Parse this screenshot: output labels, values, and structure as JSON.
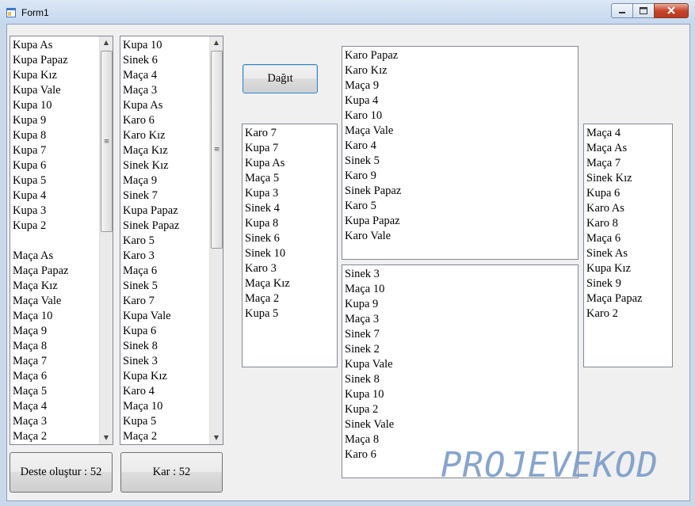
{
  "window": {
    "title": "Form1",
    "controls": [
      "minimize",
      "maximize",
      "close"
    ]
  },
  "deck_list": {
    "items": [
      "Kupa As",
      "Kupa Papaz",
      "Kupa Kız",
      "Kupa Vale",
      "Kupa 10",
      "Kupa 9",
      "Kupa 8",
      "Kupa 7",
      "Kupa 6",
      "Kupa 5",
      "Kupa 4",
      "Kupa 3",
      "Kupa 2",
      "",
      "Maça As",
      "Maça Papaz",
      "Maça Kız",
      "Maça Vale",
      "Maça 10",
      "Maça 9",
      "Maça 8",
      "Maça 7",
      "Maça 6",
      "Maça 5",
      "Maça 4",
      "Maça 3",
      "Maça 2"
    ]
  },
  "shuffled_list": {
    "items": [
      "Kupa 10",
      "Sinek 6",
      "Maça 4",
      "Maça 3",
      "Kupa As",
      "Karo 6",
      "Karo Kız",
      "Maça Kız",
      "Sinek Kız",
      "Maça 9",
      "Sinek 7",
      "Kupa Papaz",
      "Sinek Papaz",
      "Karo 5",
      "Karo 3",
      "Maça 6",
      "Sinek 5",
      "Karo 7",
      "Kupa Vale",
      "Kupa 6",
      "Sinek 8",
      "Sinek 3",
      "Kupa Kız",
      "Karo 4",
      "Maça 10",
      "Kupa 5",
      "Maça 2"
    ]
  },
  "buttons": {
    "deal": "Dağıt",
    "create_deck": "Deste oluştur : 52",
    "shuffle": "Kar : 52"
  },
  "players": {
    "left": [
      "Karo 7",
      "Kupa 7",
      "Kupa As",
      "Maça 5",
      "Kupa 3",
      "Sinek 4",
      "Kupa 8",
      "Sinek 6",
      "Sinek 10",
      "Karo 3",
      "Maça Kız",
      "Maça 2",
      "Kupa 5"
    ],
    "top": [
      "Karo Papaz",
      "Karo Kız",
      "Maça 9",
      "Kupa 4",
      "Karo 10",
      "Maça Vale",
      "Karo 4",
      "Sinek 5",
      "Karo 9",
      "Sinek Papaz",
      "Karo 5",
      "Kupa Papaz",
      "Karo Vale"
    ],
    "bottom": [
      "Sinek 3",
      "Maça 10",
      "Kupa 9",
      "Maça 3",
      "Sinek 7",
      "Sinek 2",
      "Kupa Vale",
      "Sinek 8",
      "Kupa 10",
      "Kupa 2",
      "Sinek Vale",
      "Maça 8",
      "Karo 6"
    ],
    "right": [
      "Maça 4",
      "Maça As",
      "Maça 7",
      "Sinek Kız",
      "Kupa 6",
      "Karo As",
      "Karo 8",
      "Maça 6",
      "Sinek As",
      "Kupa Kız",
      "Sinek 9",
      "Maça Papaz",
      "Karo 2"
    ]
  },
  "watermark": "PROJEVEKOD",
  "colors": {
    "titlebar": "#c5d8ee",
    "close_button": "#c8452c",
    "watermark": "#7a9bc9"
  }
}
